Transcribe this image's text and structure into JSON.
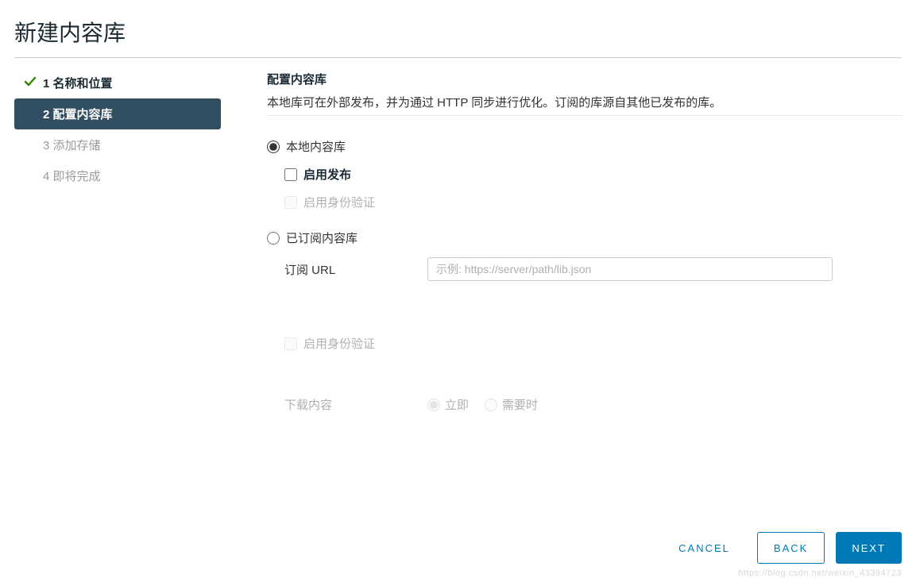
{
  "dialog": {
    "title": "新建内容库"
  },
  "sidebar": {
    "items": [
      {
        "num": "1",
        "label": "名称和位置",
        "state": "completed"
      },
      {
        "num": "2",
        "label": "配置内容库",
        "state": "active"
      },
      {
        "num": "3",
        "label": "添加存储",
        "state": "pending"
      },
      {
        "num": "4",
        "label": "即将完成",
        "state": "pending"
      }
    ]
  },
  "main": {
    "section_title": "配置内容库",
    "section_desc": "本地库可在外部发布，并为通过 HTTP 同步进行优化。订阅的库源自其他已发布的库。",
    "local": {
      "radio_label": "本地内容库",
      "enable_publish": "启用发布",
      "enable_auth": "启用身份验证"
    },
    "subscribed": {
      "radio_label": "已订阅内容库",
      "url_label": "订阅 URL",
      "url_placeholder": "示例: https://server/path/lib.json",
      "url_value": "",
      "enable_auth": "启用身份验证",
      "download_label": "下载内容",
      "immediate": "立即",
      "ondemand": "需要时"
    }
  },
  "footer": {
    "cancel": "CANCEL",
    "back": "BACK",
    "next": "NEXT"
  },
  "watermark": "https://blog.csdn.net/weixin_43394723"
}
